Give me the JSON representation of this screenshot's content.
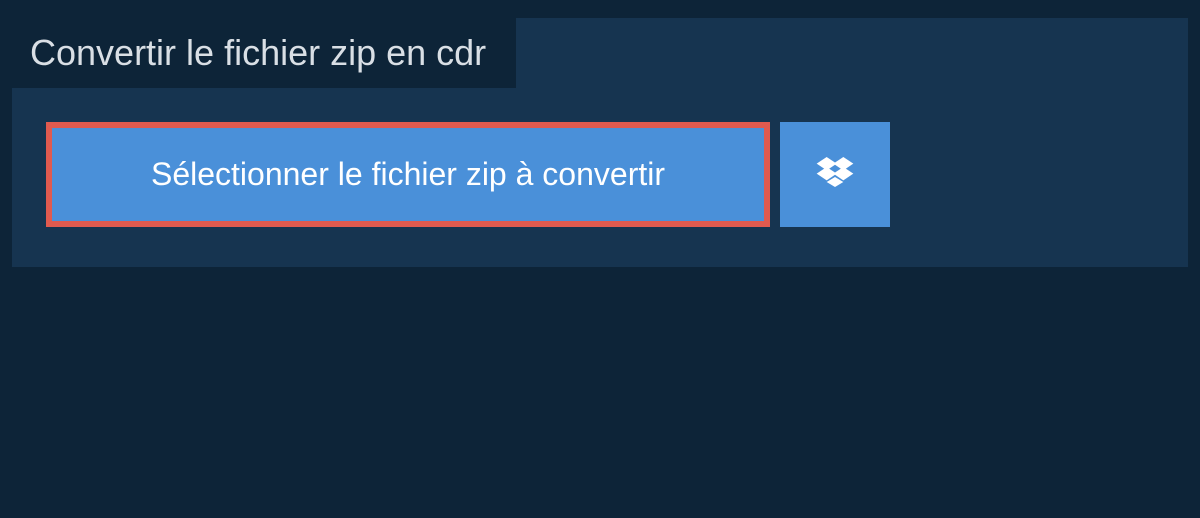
{
  "header": {
    "title": "Convertir le fichier zip en cdr"
  },
  "actions": {
    "select_file_label": "Sélectionner le fichier zip à convertir"
  }
}
